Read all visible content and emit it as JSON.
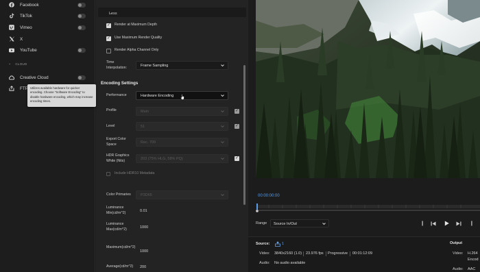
{
  "sidebar": {
    "destinations": [
      {
        "label": "Facebook",
        "icon": "facebook-icon"
      },
      {
        "label": "TikTok",
        "icon": "tiktok-icon"
      },
      {
        "label": "Vimeo",
        "icon": "vimeo-icon"
      },
      {
        "label": "X",
        "icon": "x-icon"
      },
      {
        "label": "YouTube",
        "icon": "youtube-icon"
      }
    ],
    "cloud_section": "CLOUD",
    "cloud_items": [
      {
        "label": "Creative Cloud",
        "icon": "creative-cloud-icon"
      },
      {
        "label": "FTP",
        "icon": "ftp-icon"
      }
    ]
  },
  "tooltip": {
    "text": "Utilizes available hardware for quicker encoding. Choose \"Software Encoding\" to disable hardware encoding, which may increase encoding times."
  },
  "settings": {
    "less_label": "Less",
    "render_max_depth": {
      "label": "Render at Maximum Depth",
      "checked": true
    },
    "use_max_quality": {
      "label": "Use Maximum Render Quality",
      "checked": true
    },
    "render_alpha": {
      "label": "Render Alpha Channel Only",
      "checked": false
    },
    "time_interpolation": {
      "label": "Time Interpolation:",
      "value": "Frame Sampling"
    },
    "encoding_title": "Encoding Settings",
    "performance": {
      "label": "Performance",
      "value": "Hardware Encoding"
    },
    "profile": {
      "label": "Profile",
      "value": "Main",
      "checked": true
    },
    "level": {
      "label": "Level",
      "value": "51",
      "checked": true
    },
    "export_color_space": {
      "label": "Export Color Space",
      "value": "Rec. 709"
    },
    "hdr_graphics_white": {
      "label": "HDR Graphics White (Nits)",
      "value": "203 (75% HLG, 58% PQ)",
      "checked": true
    },
    "include_hdr10": {
      "label": "Include HDR10 Metadata",
      "checked": false
    },
    "color_primaries": {
      "label": "Color Primaries",
      "value": "P3D65"
    },
    "luminance_min": {
      "label": "Luminance Min(cd/m^2)",
      "value": "0.01"
    },
    "luminance_max": {
      "label": "Luminance Max(cd/m^2)",
      "value": "1000"
    },
    "maximum": {
      "label": "Maximum(cd/m^2)",
      "value": "1000"
    },
    "average": {
      "label": "Average(cd/m^2)",
      "value": "200"
    }
  },
  "preview": {
    "timecode": "00:00:00:00",
    "range_label": "Range",
    "range_value": "Source In/Out"
  },
  "info": {
    "source_label": "Source:",
    "source_count": "1",
    "video_label": "Video:",
    "video_res": "3840x2160 (1.0)",
    "video_fps": "23.976 fps",
    "video_scan": "Progressive",
    "video_duration": "00:01:12:09",
    "audio_label": "Audio:",
    "audio_value": "No audio available",
    "output_label": "Output",
    "out_video_label": "Video:",
    "out_video_value": "H.264",
    "out_video_value2": "Encod",
    "out_audio_label": "Audio:",
    "out_audio_value": "AAC"
  },
  "colors": {
    "accent_blue": "#5a9de8",
    "panel_bg": "#232323",
    "sidebar_bg": "#1d1d1d"
  }
}
